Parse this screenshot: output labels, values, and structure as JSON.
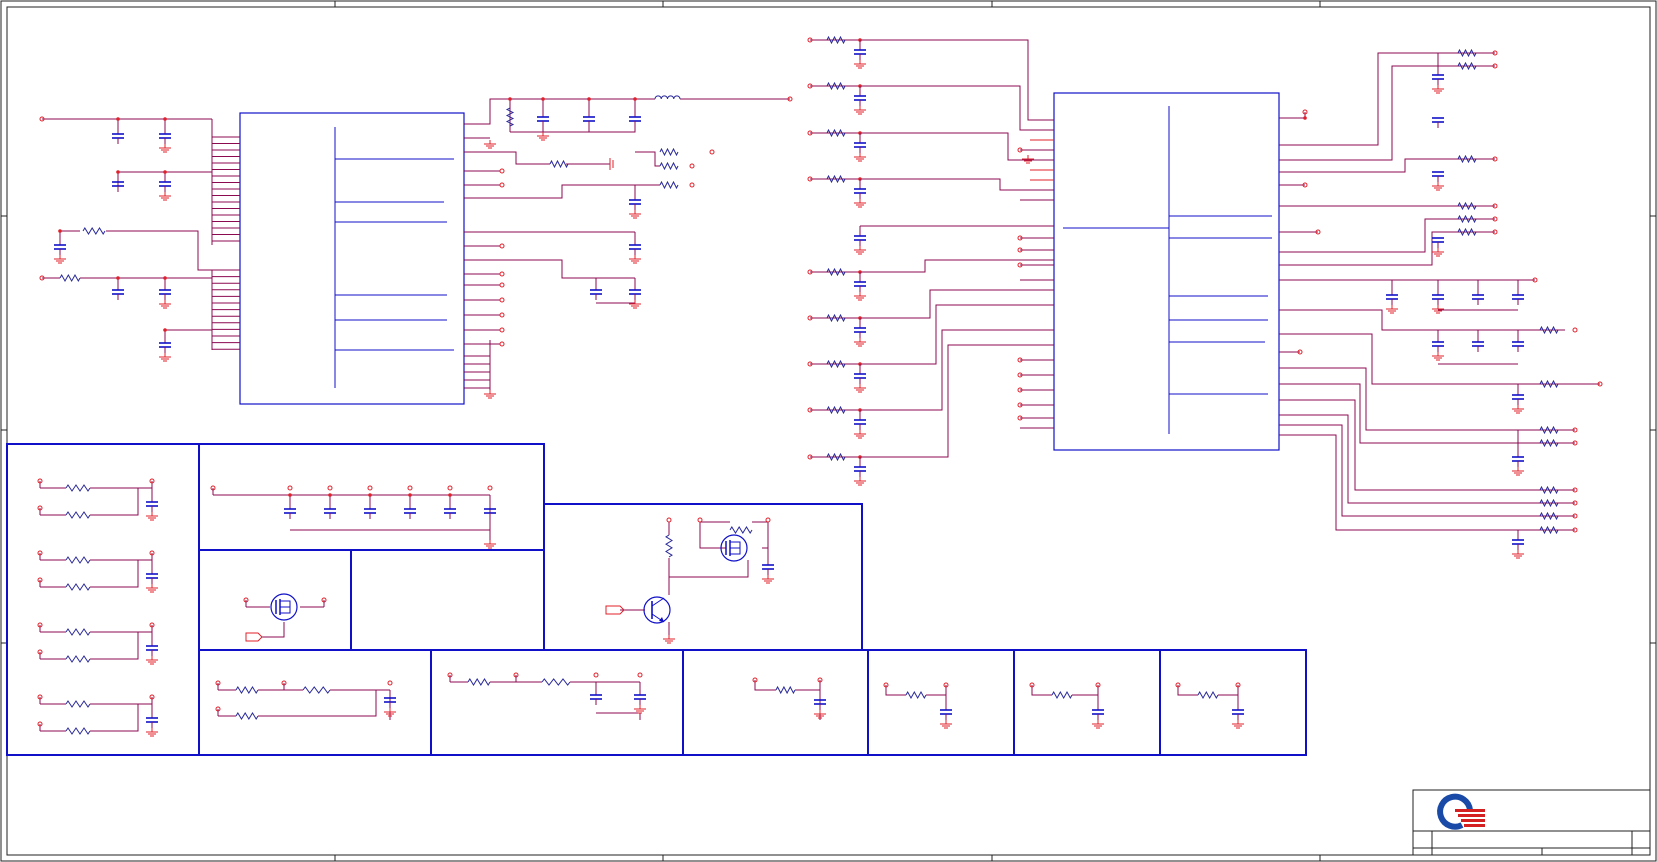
{
  "colors": {
    "wire": "#8b0a50",
    "pin": "#e0202a",
    "part": "#1010c8",
    "frame": "#202020",
    "logo_blue": "#1a4aa8",
    "logo_red": "#d42020"
  },
  "title_block": {
    "logo": "company-logo-icon"
  }
}
